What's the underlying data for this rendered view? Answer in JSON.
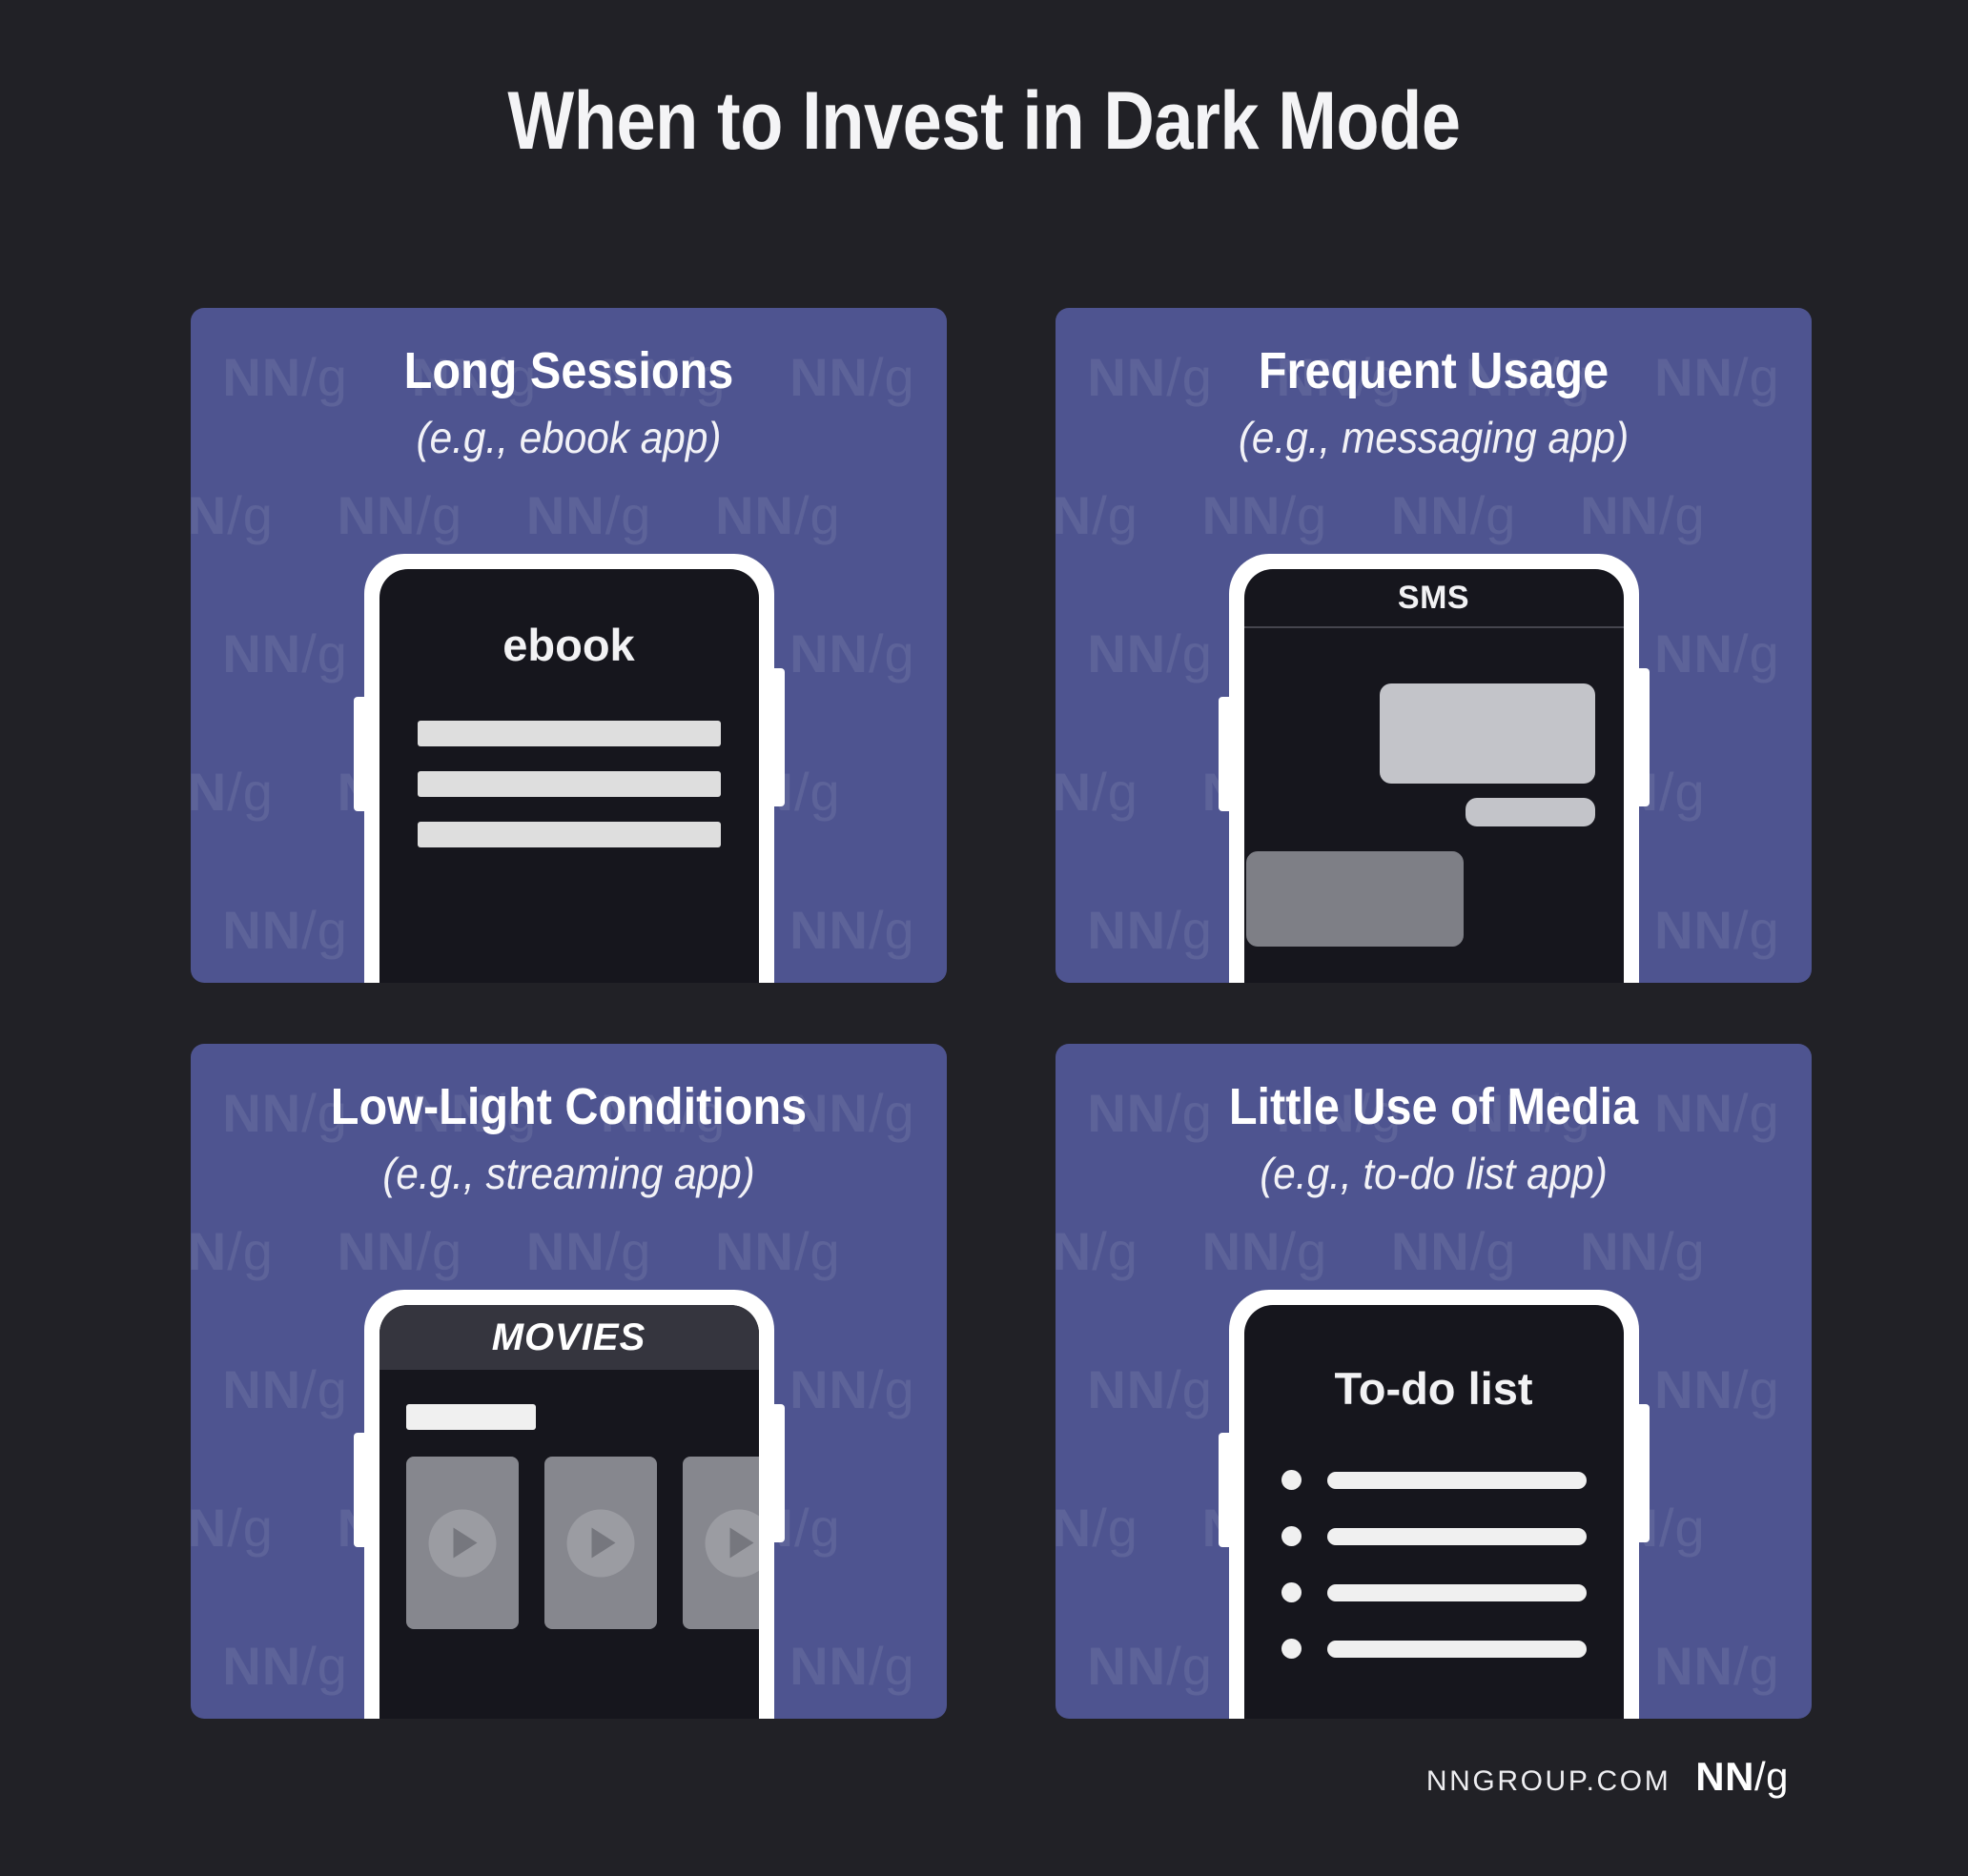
{
  "page": {
    "title": "When to Invest in Dark Mode",
    "background_color": "#212126",
    "card_color": "#4e5490",
    "watermark_text": "NN/g"
  },
  "cards": [
    {
      "title": "Long Sessions",
      "subtitle": "(e.g., ebook app)",
      "phone": {
        "kind": "ebook",
        "screen_title": "ebook",
        "text_lines": 3
      }
    },
    {
      "title": "Frequent Usage",
      "subtitle": "(e.g., messaging app)",
      "phone": {
        "kind": "sms",
        "screen_title": "SMS",
        "bubbles": 3
      }
    },
    {
      "title": "Low-Light Conditions",
      "subtitle": "(e.g., streaming app)",
      "phone": {
        "kind": "movies",
        "screen_title": "MOVIES",
        "thumbnails": 3
      }
    },
    {
      "title": "Little Use of Media",
      "subtitle": "(e.g., to-do list app)",
      "phone": {
        "kind": "todo",
        "screen_title": "To-do list",
        "items": 4
      }
    }
  ],
  "footer": {
    "url": "NNGROUP.COM",
    "logo_bold": "NN",
    "logo_slash": "/g"
  }
}
